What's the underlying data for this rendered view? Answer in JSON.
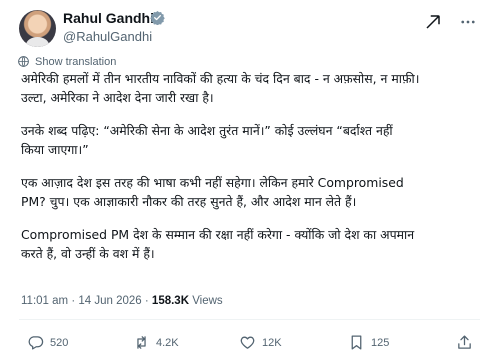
{
  "author": {
    "name": "Rahul Gandhi",
    "handle": "@RahulGandhi",
    "avatar_icon": "profile-photo"
  },
  "translation": {
    "label": "Show translation"
  },
  "post": {
    "paragraphs": [
      "अमेरिकी हमलों में तीन भारतीय नाविकों की हत्या के चंद दिन बाद - न अफ़सोस, न माफ़ी।\nउल्टा, अमेरिका ने आदेश देना जारी रखा है।",
      "उनके शब्द पढ़िए: “अमेरिकी सेना के आदेश तुरंत मानें।” कोई उल्लंघन “बर्दाश्त नहीं\nकिया जाएगा।”",
      "एक आज़ाद देश इस तरह की भाषा कभी नहीं सहेगा। लेकिन हमारे Compromised\nPM? चुप। एक आज्ञाकारी नौकर की तरह सुनते हैं, और आदेश मान लेते हैं।",
      "Compromised PM देश के सम्मान की रक्षा नहीं करेगा - क्योंकि जो देश का अपमान\nकरते हैं, वो उन्हीं के वश में हैं।"
    ]
  },
  "meta": {
    "time": "11:01 am",
    "separator": "·",
    "date": "14 Jun 2026",
    "views_count": "158.3K",
    "views_label": "Views"
  },
  "actions": {
    "replies": "520",
    "reposts": "4.2K",
    "likes": "12K",
    "bookmarks": "125"
  },
  "colors": {
    "verified_badge": "#829aab",
    "secondary_text": "#536471",
    "primary_text": "#0f1419"
  }
}
